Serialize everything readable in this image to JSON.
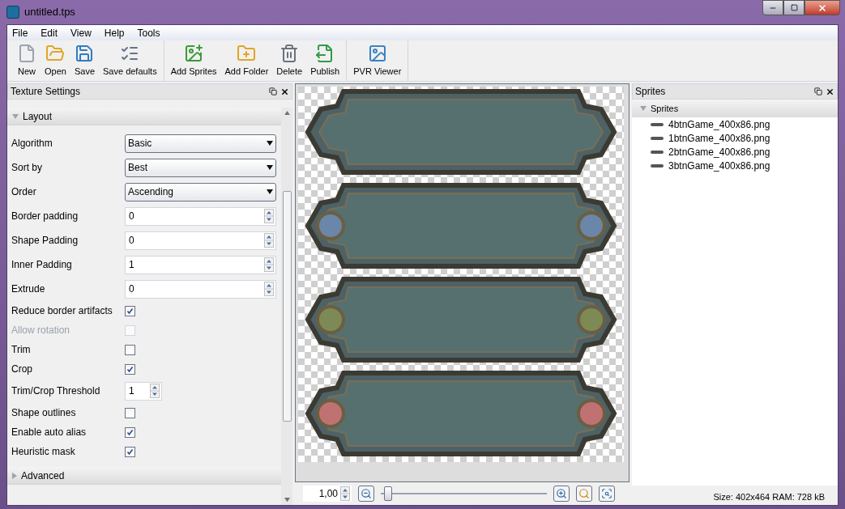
{
  "window": {
    "title": "untitled.tps"
  },
  "menu": [
    "File",
    "Edit",
    "View",
    "Help",
    "Tools"
  ],
  "toolbar_groups": [
    [
      "New",
      "Open",
      "Save",
      "Save defaults"
    ],
    [
      "Add Sprites",
      "Add Folder",
      "Delete",
      "Publish"
    ],
    [
      "PVR Viewer"
    ]
  ],
  "settings_panel": {
    "title": "Texture Settings",
    "sections": [
      {
        "label": "Layout",
        "expanded": true,
        "rows": [
          {
            "kind": "select",
            "label": "Algorithm",
            "value": "Basic"
          },
          {
            "kind": "select",
            "label": "Sort by",
            "value": "Best"
          },
          {
            "kind": "select",
            "label": "Order",
            "value": "Ascending"
          },
          {
            "kind": "spin",
            "label": "Border padding",
            "value": "0"
          },
          {
            "kind": "spin",
            "label": "Shape Padding",
            "value": "0"
          },
          {
            "kind": "spin",
            "label": "Inner Padding",
            "value": "1"
          },
          {
            "kind": "spin",
            "label": "Extrude",
            "value": "0"
          },
          {
            "kind": "check",
            "label": "Reduce border artifacts",
            "checked": true,
            "disabled": false
          },
          {
            "kind": "check",
            "label": "Allow rotation",
            "checked": false,
            "disabled": true
          },
          {
            "kind": "check",
            "label": "Trim",
            "checked": false,
            "disabled": false
          },
          {
            "kind": "check",
            "label": "Crop",
            "checked": true,
            "disabled": false
          },
          {
            "kind": "smallspin",
            "label": "Trim/Crop Threshold",
            "value": "1"
          },
          {
            "kind": "check",
            "label": "Shape outlines",
            "checked": false,
            "disabled": false
          },
          {
            "kind": "check",
            "label": "Enable auto alias",
            "checked": true,
            "disabled": false
          },
          {
            "kind": "check",
            "label": "Heuristic mask",
            "checked": true,
            "disabled": false
          }
        ]
      },
      {
        "label": "Advanced",
        "expanded": false
      }
    ]
  },
  "canvas": {
    "zoom_value": "1,00",
    "zoom": {
      "level": 0.02
    }
  },
  "sprites_panel": {
    "title": "Sprites",
    "tree": [
      {
        "label": "Sprites",
        "expanded": true,
        "children": [
          {
            "label": "4btnGame_400x86.png"
          },
          {
            "label": "1btnGame_400x86.png"
          },
          {
            "label": "2btnGame_400x86.png"
          },
          {
            "label": "3btnGame_400x86.png"
          }
        ]
      }
    ]
  },
  "status_bar": "Size: 402x464 RAM: 728 kB"
}
